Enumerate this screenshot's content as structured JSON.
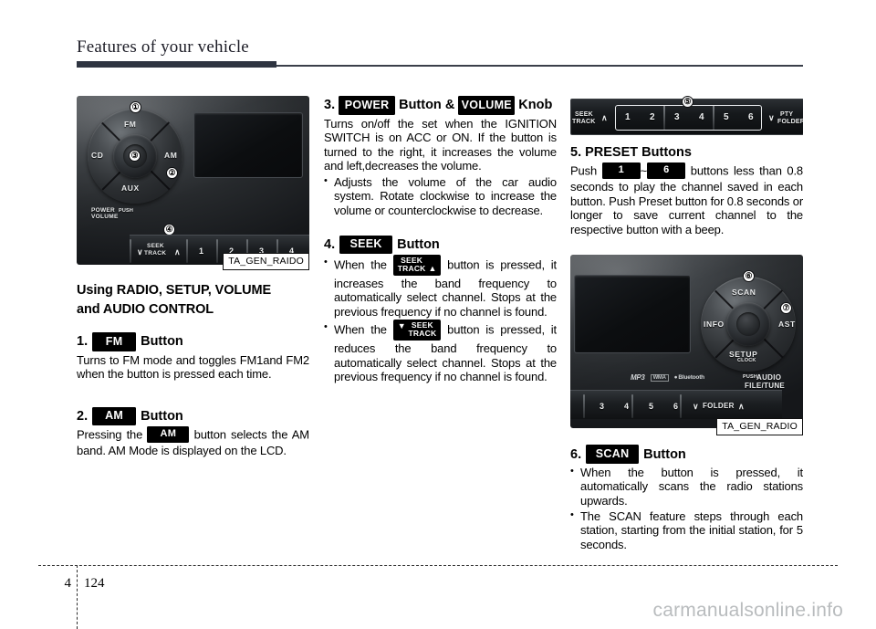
{
  "header": {
    "title": "Features of your vehicle"
  },
  "footer": {
    "chapter": "4",
    "page": "124",
    "watermark": "carmanualsonline.info"
  },
  "figures": {
    "radio_1": {
      "caption": "TA_GEN_RAIDO",
      "labels": {
        "fm": "FM",
        "am": "AM",
        "cd": "CD",
        "aux": "AUX",
        "power": "POWER",
        "push": "PUSH",
        "volume": "VOLUME",
        "seek": "SEEK",
        "track": "TRACK",
        "chevron_down": "∨",
        "chevron_up": "∧"
      },
      "callouts": [
        "①",
        "②",
        "③",
        "④"
      ],
      "preset_numbers": [
        "1",
        "2",
        "3",
        "4"
      ]
    },
    "preset_bar": {
      "seek": "SEEK",
      "track": "TRACK",
      "chevron_up": "∧",
      "chevron_down": "∨",
      "pty": "PTY",
      "folder": "FOLDER",
      "callout": "⑤",
      "numbers": [
        "1",
        "2",
        "3",
        "4",
        "5",
        "6"
      ]
    },
    "radio_2": {
      "caption": "TA_GEN_RADIO",
      "labels": {
        "scan": "SCAN",
        "info": "INFO",
        "ast": "AST",
        "setup": "SETUP",
        "clock": "CLOCK",
        "push": "PUSH",
        "audio": "AUDIO",
        "file_tune": "FILE/TUNE",
        "folder": "FOLDER",
        "chevron_down": "∨",
        "chevron_up": "∧",
        "mp3": "MP3",
        "wma": "WMA",
        "bluetooth": "Bluetooth"
      },
      "callouts": [
        "⑥",
        "⑦"
      ],
      "preset_numbers": [
        "3",
        "4",
        "5",
        "6"
      ]
    }
  },
  "col1": {
    "section_heading_line1": "Using RADIO, SETUP, VOLUME",
    "section_heading_line2": "and AUDIO CONTROL",
    "item1": {
      "number": "1.",
      "chip": "FM",
      "suffix": "Button",
      "body": "Turns to FM mode and toggles FM1and FM2 when the button is pressed each time."
    },
    "item2": {
      "number": "2.",
      "chip": "AM",
      "suffix": "Button",
      "body_before": "Pressing the",
      "body_chip": "AM",
      "body_after": "button selects the AM band. AM Mode is displayed on the LCD."
    }
  },
  "col2": {
    "item3": {
      "number": "3.",
      "chip1": "POWER",
      "mid": "Button &",
      "chip2": "VOLUME",
      "suffix": "Knob",
      "body": "Turns on/off the set when the IGNITION SWITCH is on ACC or ON. If the button is turned to the right, it increases the volume and left,decreases the volume.",
      "bullets": [
        "Adjusts the volume of the car audio system. Rotate clockwise to increase the volume or counterclockwise to decrease."
      ]
    },
    "item4": {
      "number": "4.",
      "chip": "SEEK",
      "suffix": "Button",
      "bullet1_before": "When the",
      "bullet1_after": "button is pressed, it increases the band frequency to automatically select channel. Stops at the previous frequency if no channel is found.",
      "bullet2_before": "When the",
      "bullet2_after": "button is pressed, it reduces the band frequency to automatically select channel. Stops at the previous frequency if no channel is found.",
      "seek_chip_line1": "SEEK",
      "seek_chip_line2": "TRACK"
    }
  },
  "col3": {
    "item5": {
      "heading": "5. PRESET Buttons",
      "body_before": "Push",
      "chip_low": "1",
      "tilde": "~",
      "chip_high": "6",
      "body_after": "buttons less than 0.8 seconds to play the channel saved in each button. Push Preset button for 0.8 seconds or longer to save current channel to the respective button with a beep."
    },
    "item6": {
      "number": "6.",
      "chip": "SCAN",
      "suffix": "Button",
      "bullets": [
        "When the button is pressed, it automatically scans the radio stations upwards.",
        "The SCAN feature steps through each station, starting from the initial station, for 5 seconds."
      ]
    }
  }
}
